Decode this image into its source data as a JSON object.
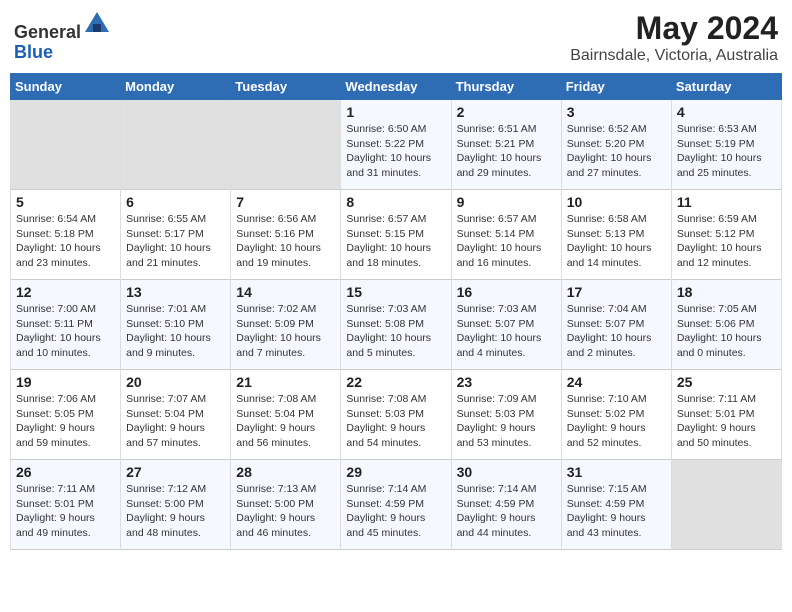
{
  "header": {
    "logo_general": "General",
    "logo_blue": "Blue",
    "month_title": "May 2024",
    "location": "Bairnsdale, Victoria, Australia"
  },
  "days_of_week": [
    "Sunday",
    "Monday",
    "Tuesday",
    "Wednesday",
    "Thursday",
    "Friday",
    "Saturday"
  ],
  "weeks": [
    {
      "days": [
        {
          "num": "",
          "info": "",
          "empty": true
        },
        {
          "num": "",
          "info": "",
          "empty": true
        },
        {
          "num": "",
          "info": "",
          "empty": true
        },
        {
          "num": "1",
          "info": "Sunrise: 6:50 AM\nSunset: 5:22 PM\nDaylight: 10 hours\nand 31 minutes."
        },
        {
          "num": "2",
          "info": "Sunrise: 6:51 AM\nSunset: 5:21 PM\nDaylight: 10 hours\nand 29 minutes."
        },
        {
          "num": "3",
          "info": "Sunrise: 6:52 AM\nSunset: 5:20 PM\nDaylight: 10 hours\nand 27 minutes."
        },
        {
          "num": "4",
          "info": "Sunrise: 6:53 AM\nSunset: 5:19 PM\nDaylight: 10 hours\nand 25 minutes."
        }
      ]
    },
    {
      "days": [
        {
          "num": "5",
          "info": "Sunrise: 6:54 AM\nSunset: 5:18 PM\nDaylight: 10 hours\nand 23 minutes."
        },
        {
          "num": "6",
          "info": "Sunrise: 6:55 AM\nSunset: 5:17 PM\nDaylight: 10 hours\nand 21 minutes."
        },
        {
          "num": "7",
          "info": "Sunrise: 6:56 AM\nSunset: 5:16 PM\nDaylight: 10 hours\nand 19 minutes."
        },
        {
          "num": "8",
          "info": "Sunrise: 6:57 AM\nSunset: 5:15 PM\nDaylight: 10 hours\nand 18 minutes."
        },
        {
          "num": "9",
          "info": "Sunrise: 6:57 AM\nSunset: 5:14 PM\nDaylight: 10 hours\nand 16 minutes."
        },
        {
          "num": "10",
          "info": "Sunrise: 6:58 AM\nSunset: 5:13 PM\nDaylight: 10 hours\nand 14 minutes."
        },
        {
          "num": "11",
          "info": "Sunrise: 6:59 AM\nSunset: 5:12 PM\nDaylight: 10 hours\nand 12 minutes."
        }
      ]
    },
    {
      "days": [
        {
          "num": "12",
          "info": "Sunrise: 7:00 AM\nSunset: 5:11 PM\nDaylight: 10 hours\nand 10 minutes."
        },
        {
          "num": "13",
          "info": "Sunrise: 7:01 AM\nSunset: 5:10 PM\nDaylight: 10 hours\nand 9 minutes."
        },
        {
          "num": "14",
          "info": "Sunrise: 7:02 AM\nSunset: 5:09 PM\nDaylight: 10 hours\nand 7 minutes."
        },
        {
          "num": "15",
          "info": "Sunrise: 7:03 AM\nSunset: 5:08 PM\nDaylight: 10 hours\nand 5 minutes."
        },
        {
          "num": "16",
          "info": "Sunrise: 7:03 AM\nSunset: 5:07 PM\nDaylight: 10 hours\nand 4 minutes."
        },
        {
          "num": "17",
          "info": "Sunrise: 7:04 AM\nSunset: 5:07 PM\nDaylight: 10 hours\nand 2 minutes."
        },
        {
          "num": "18",
          "info": "Sunrise: 7:05 AM\nSunset: 5:06 PM\nDaylight: 10 hours\nand 0 minutes."
        }
      ]
    },
    {
      "days": [
        {
          "num": "19",
          "info": "Sunrise: 7:06 AM\nSunset: 5:05 PM\nDaylight: 9 hours\nand 59 minutes."
        },
        {
          "num": "20",
          "info": "Sunrise: 7:07 AM\nSunset: 5:04 PM\nDaylight: 9 hours\nand 57 minutes."
        },
        {
          "num": "21",
          "info": "Sunrise: 7:08 AM\nSunset: 5:04 PM\nDaylight: 9 hours\nand 56 minutes."
        },
        {
          "num": "22",
          "info": "Sunrise: 7:08 AM\nSunset: 5:03 PM\nDaylight: 9 hours\nand 54 minutes."
        },
        {
          "num": "23",
          "info": "Sunrise: 7:09 AM\nSunset: 5:03 PM\nDaylight: 9 hours\nand 53 minutes."
        },
        {
          "num": "24",
          "info": "Sunrise: 7:10 AM\nSunset: 5:02 PM\nDaylight: 9 hours\nand 52 minutes."
        },
        {
          "num": "25",
          "info": "Sunrise: 7:11 AM\nSunset: 5:01 PM\nDaylight: 9 hours\nand 50 minutes."
        }
      ]
    },
    {
      "days": [
        {
          "num": "26",
          "info": "Sunrise: 7:11 AM\nSunset: 5:01 PM\nDaylight: 9 hours\nand 49 minutes."
        },
        {
          "num": "27",
          "info": "Sunrise: 7:12 AM\nSunset: 5:00 PM\nDaylight: 9 hours\nand 48 minutes."
        },
        {
          "num": "28",
          "info": "Sunrise: 7:13 AM\nSunset: 5:00 PM\nDaylight: 9 hours\nand 46 minutes."
        },
        {
          "num": "29",
          "info": "Sunrise: 7:14 AM\nSunset: 4:59 PM\nDaylight: 9 hours\nand 45 minutes."
        },
        {
          "num": "30",
          "info": "Sunrise: 7:14 AM\nSunset: 4:59 PM\nDaylight: 9 hours\nand 44 minutes."
        },
        {
          "num": "31",
          "info": "Sunrise: 7:15 AM\nSunset: 4:59 PM\nDaylight: 9 hours\nand 43 minutes."
        },
        {
          "num": "",
          "info": "",
          "empty": true
        }
      ]
    }
  ]
}
